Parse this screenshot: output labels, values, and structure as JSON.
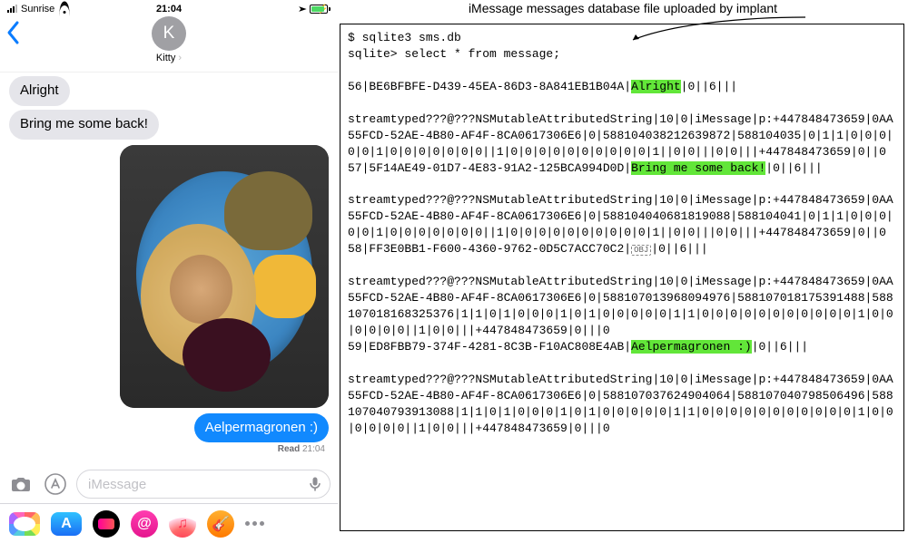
{
  "status_bar": {
    "carrier": "Sunrise",
    "time": "21:04"
  },
  "nav": {
    "contact_initial": "K",
    "contact_name": "Kitty"
  },
  "messages": {
    "recv1": "Alright",
    "recv2": "Bring me some back!",
    "sent1": "Aelpermagronen :)",
    "read_label": "Read",
    "read_time": "21:04"
  },
  "input": {
    "placeholder": "iMessage"
  },
  "appstore_glyph": "A",
  "music_glyph": "♫",
  "gband_glyph": "🎸",
  "right": {
    "caption": "iMessage messages database file uploaded by implant",
    "cmd_prompt": "$ sqlite3 sms.db",
    "query": "sqlite> select * from message;",
    "row1_pre": "56|BE6BFBFE-D439-45EA-86D3-8A841EB1B04A|",
    "row1_hl": "Alright",
    "row1_post": "|0||6|||",
    "stream1": "streamtyped???@???NSMutableAttributedString|10|0|iMessage|p:+447848473659|0AA55FCD-52AE-4B80-AF4F-8CA0617306E6|0|588104038212639872|588104035|0|1|1|0|0|0|0|0|1|0|0|0|0|0|0|0||1|0|0|0|0|0|0|0|0|0|0|1||0|0|||0|0|||+447848473659|0||0",
    "row2_pre": "57|5F14AE49-01D7-4E83-91A2-125BCA994D0D|",
    "row2_hl": "Bring me some back!",
    "row2_post": "|0||6|||",
    "stream2": "streamtyped???@???NSMutableAttributedString|10|0|iMessage|p:+447848473659|0AA55FCD-52AE-4B80-AF4F-8CA0617306E6|0|588104040681819088|588104041|0|1|1|0|0|0|0|0|1|0|0|0|0|0|0|0||1|0|0|0|0|0|0|0|0|0|0|1||0|0|||0|0|||+447848473659|0||0",
    "row3_pre": "58|FF3E0BB1-F600-4360-9762-0D5C7ACC70C2|",
    "row3_post": "|0||6|||",
    "stream3": "streamtyped???@???NSMutableAttributedString|10|0|iMessage|p:+447848473659|0AA55FCD-52AE-4B80-AF4F-8CA0617306E6|0|588107013968094976|588107018175391488|588107018168325376|1|1|0|1|0|0|0|1|0|1|0|0|0|0|0|1|1|0|0|0|0|0|0|0|0|0|0|0|1|0|0|0|0|0|0||1|0|0|||+447848473659|0|||0",
    "row4_pre": "59|ED8FBB79-374F-4281-8C3B-F10AC808E4AB|",
    "row4_hl": "Aelpermagronen :)",
    "row4_post": "|0||6|||",
    "stream4": "streamtyped???@???NSMutableAttributedString|10|0|iMessage|p:+447848473659|0AA55FCD-52AE-4B80-AF4F-8CA0617306E6|0|588107037624904064|588107040798506496|588107040793913088|1|1|0|1|0|0|0|1|0|1|0|0|0|0|0|1|1|0|0|0|0|0|0|0|0|0|0|0|1|0|0|0|0|0|0||1|0|0|||+447848473659|0|||0"
  }
}
